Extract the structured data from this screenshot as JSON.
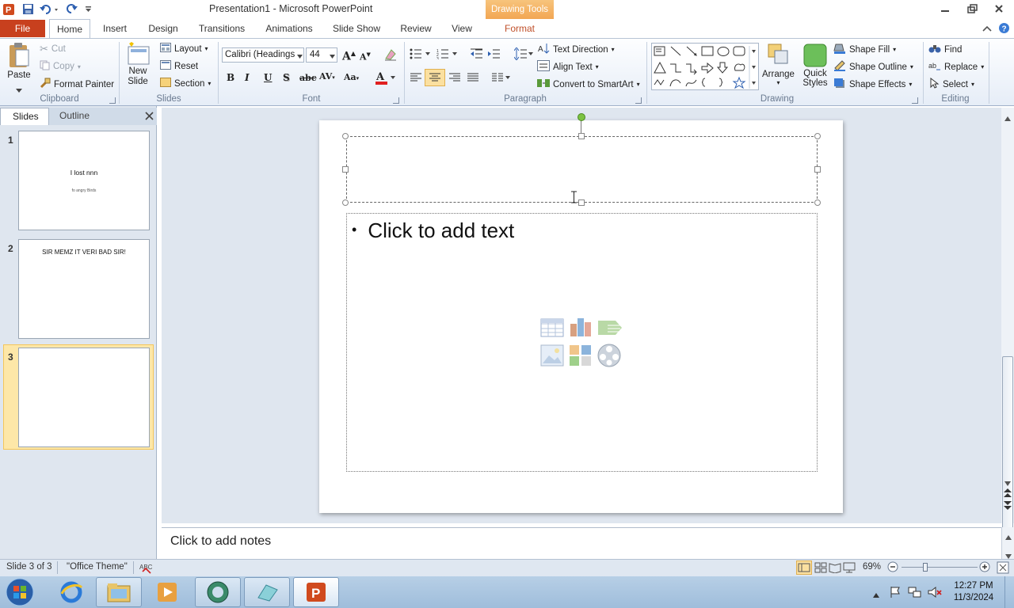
{
  "titlebar": {
    "title": "Presentation1  -  Microsoft PowerPoint",
    "contextual_tab": "Drawing Tools"
  },
  "tabs": {
    "file": "File",
    "home": "Home",
    "insert": "Insert",
    "design": "Design",
    "transitions": "Transitions",
    "animations": "Animations",
    "slide_show": "Slide Show",
    "review": "Review",
    "view": "View",
    "format": "Format"
  },
  "ribbon": {
    "clipboard": {
      "paste": "Paste",
      "cut": "Cut",
      "copy": "Copy",
      "format_painter": "Format Painter",
      "label": "Clipboard"
    },
    "slides": {
      "new_slide_1": "New",
      "new_slide_2": "Slide",
      "layout": "Layout",
      "reset": "Reset",
      "section": "Section",
      "label": "Slides"
    },
    "font": {
      "family": "Calibri (Headings",
      "size": "44",
      "label": "Font"
    },
    "paragraph": {
      "text_direction": "Text Direction",
      "align_text": "Align Text",
      "convert_smartart": "Convert to SmartArt",
      "label": "Paragraph"
    },
    "drawing": {
      "arrange": "Arrange",
      "quick_1": "Quick",
      "quick_2": "Styles",
      "shape_fill": "Shape Fill",
      "shape_outline": "Shape Outline",
      "shape_effects": "Shape Effects",
      "label": "Drawing"
    },
    "editing": {
      "find": "Find",
      "replace": "Replace",
      "select": "Select",
      "label": "Editing"
    }
  },
  "pane": {
    "tab_slides": "Slides",
    "tab_outline": "Outline"
  },
  "thumbnails": [
    {
      "num": "1",
      "title": "I lost nnn",
      "subtitle": "fo angry  Birds"
    },
    {
      "num": "2",
      "title": "SIR MEMZ IT VERI BAD SIR!"
    },
    {
      "num": "3"
    }
  ],
  "slide": {
    "body_placeholder": "Click to add text"
  },
  "notes": {
    "placeholder": "Click to add notes"
  },
  "status": {
    "slide_info": "Slide 3 of 3",
    "theme": "\"Office Theme\"",
    "zoom": "69%"
  },
  "taskbar": {
    "time": "12:27 PM",
    "date": "11/3/2024"
  },
  "colors": {
    "file_tab": "#c8401e",
    "accent_orange": "#f2a552",
    "ribbon_blue": "#e6edf7",
    "selection_gold": "#f5c65a"
  }
}
